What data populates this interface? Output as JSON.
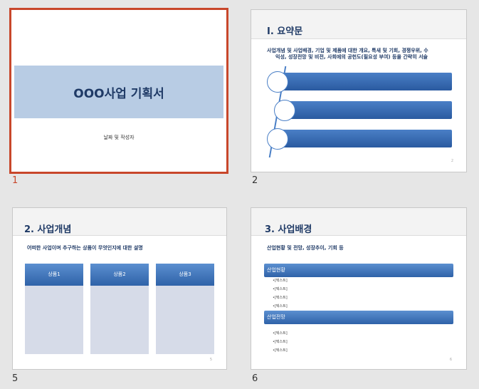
{
  "slides": [
    {
      "number": "1",
      "title": "OOO사업 기획서",
      "subtitle": "날짜 및 작성자"
    },
    {
      "number": "2",
      "title": "Ⅰ. 요약문",
      "description_line1": "사업개념 및 사업배경, 기업 및 제품에 대한 개요, 특새 및 기회, 경쟁우위, 수",
      "description_line2": "익성, 성장전망 및 비전, 사회에의 공헌도(필요성 부여) 등을 간략히 서술",
      "page": "2"
    },
    {
      "number": "5",
      "title": "2. 사업개념",
      "description": "어떠한 사업이며 추구하는 상품이 무엇인지에 대한 설명",
      "products": [
        "상품1",
        "상품2",
        "상품3"
      ],
      "page": "5"
    },
    {
      "number": "6",
      "title": "3. 사업배경",
      "description": "산업현황 및 전망, 성장추이, 기회 등",
      "section1": "산업현황",
      "section1_items": [
        "•[텍스트]",
        "•[텍스트]",
        "•[텍스트]",
        "•[텍스트]"
      ],
      "section2": "산업전망",
      "section2_items": [
        "•[텍스트]",
        "•[텍스트]",
        "•[텍스트]"
      ],
      "page": "6"
    }
  ],
  "colors": {
    "selection": "#c8472b",
    "accent": "#2a5aa0",
    "title_band": "#b8cce4"
  }
}
